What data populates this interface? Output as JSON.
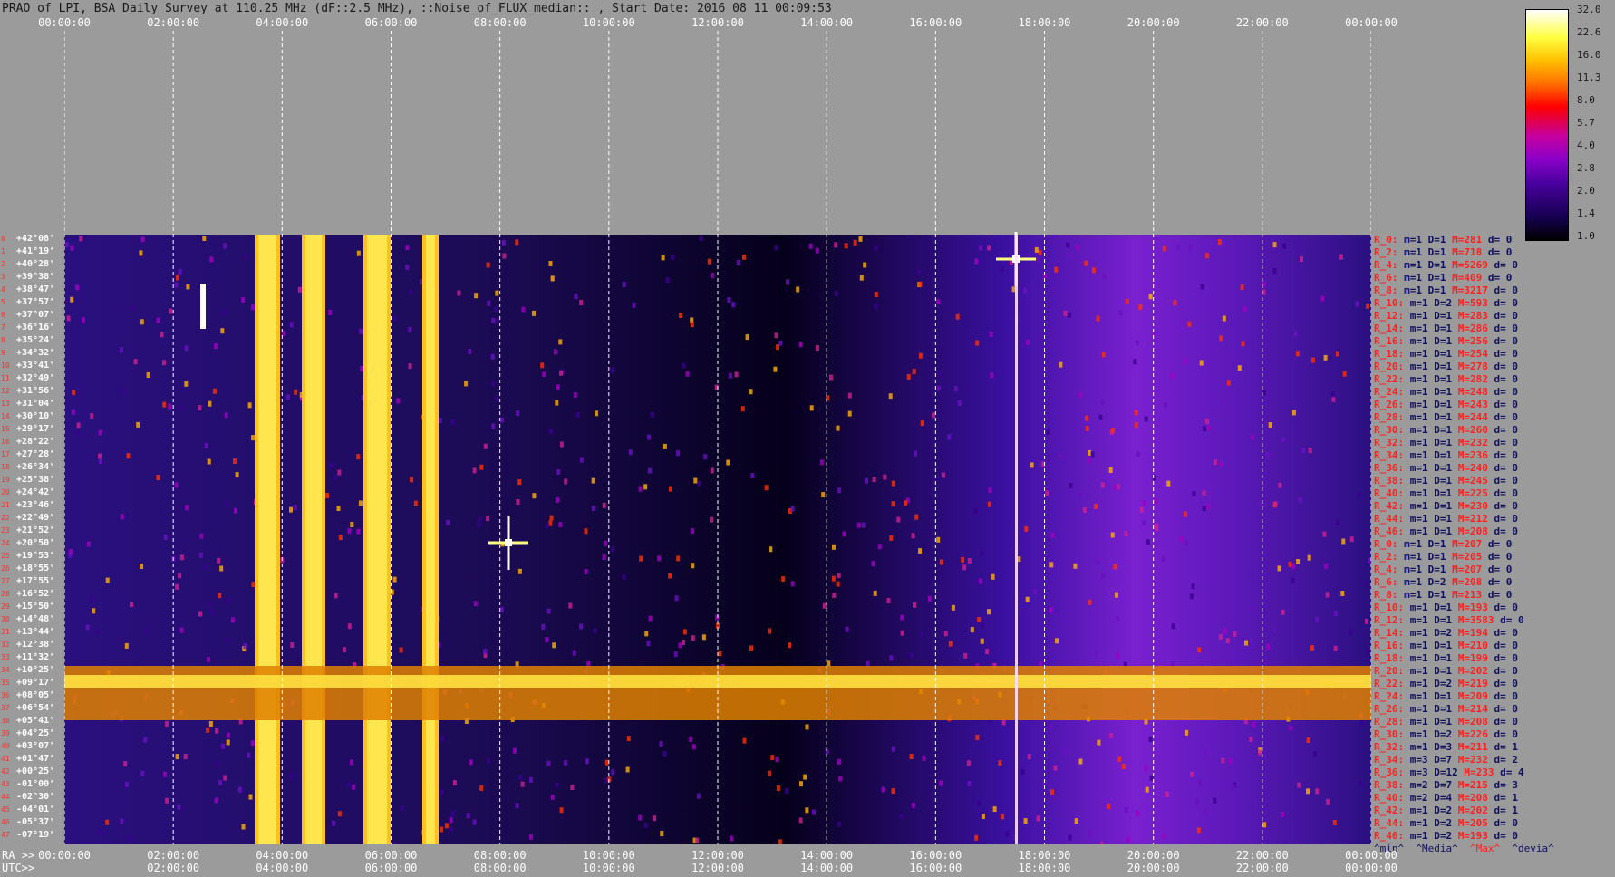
{
  "title": "PRAO of LPI, BSA Daily Survey at 110.25 MHz (dF::2.5 MHz), ::Noise_of_FLUX_median:: , Start Date: 2016 08 11 00:09:53",
  "chart_data": {
    "type": "heatmap",
    "x_ticks_top": [
      "00:00:00",
      "02:00:00",
      "04:00:00",
      "06:00:00",
      "08:00:00",
      "10:00:00",
      "12:00:00",
      "14:00:00",
      "16:00:00",
      "18:00:00",
      "20:00:00",
      "22:00:00",
      "00:00:00"
    ],
    "ra_ticks": [
      "00:00:00",
      "02:00:00",
      "04:00:00",
      "06:00:00",
      "08:00:00",
      "10:00:00",
      "12:00:00",
      "14:00:00",
      "16:00:00",
      "18:00:00",
      "20:00:00",
      "22:00:00",
      "00:00:00"
    ],
    "utc_ticks": [
      "02:00:00",
      "04:00:00",
      "06:00:00",
      "08:00:00",
      "10:00:00",
      "12:00:00",
      "14:00:00",
      "16:00:00",
      "18:00:00",
      "20:00:00",
      "22:00:00",
      "00:00:00"
    ],
    "ra_label": "RA >>",
    "utc_label": "UTC>>",
    "declinations": [
      "+42°08'",
      "+41°19'",
      "+40°28'",
      "+39°38'",
      "+38°47'",
      "+37°57'",
      "+37°07'",
      "+36°16'",
      "+35°24'",
      "+34°32'",
      "+33°41'",
      "+32°49'",
      "+31°56'",
      "+31°04'",
      "+30°10'",
      "+29°17'",
      "+28°22'",
      "+27°28'",
      "+26°34'",
      "+25°38'",
      "+24°42'",
      "+23°46'",
      "+22°49'",
      "+21°52'",
      "+20°50'",
      "+19°53'",
      "+18°55'",
      "+17°55'",
      "+16°52'",
      "+15°50'",
      "+14°48'",
      "+13°44'",
      "+12°38'",
      "+11°32'",
      "+10°25'",
      "+09°17'",
      "+08°05'",
      "+06°54'",
      "+05°41'",
      "+04°25'",
      "+03°07'",
      "+01°47'",
      "+00°25'",
      "-01°00'",
      "-02°30'",
      "-04°01'",
      "-05°37'",
      "-07°19'"
    ],
    "colorbar_ticks": [
      "32.0",
      "22.6",
      "16.0",
      "11.3",
      "8.0",
      "5.7",
      "4.0",
      "2.8",
      "2.0",
      "1.4",
      "1.0"
    ],
    "row_stats": [
      {
        "label": "R_0:",
        "m": "m=1",
        "D": "D=1",
        "M": "M=281",
        "d": "d= 0"
      },
      {
        "label": "R_2:",
        "m": "m=1",
        "D": "D=1",
        "M": "M=718",
        "d": "d= 0"
      },
      {
        "label": "R_4:",
        "m": "m=1",
        "D": "D=1",
        "M": "M=5269",
        "d": "d= 0"
      },
      {
        "label": "R_6:",
        "m": "m=1",
        "D": "D=1",
        "M": "M=409",
        "d": "d= 0"
      },
      {
        "label": "R_8:",
        "m": "m=1",
        "D": "D=1",
        "M": "M=3217",
        "d": "d= 0"
      },
      {
        "label": "R_10:",
        "m": "m=1",
        "D": "D=2",
        "M": "M=593",
        "d": "d= 0"
      },
      {
        "label": "R_12:",
        "m": "m=1",
        "D": "D=1",
        "M": "M=283",
        "d": "d= 0"
      },
      {
        "label": "R_14:",
        "m": "m=1",
        "D": "D=1",
        "M": "M=286",
        "d": "d= 0"
      },
      {
        "label": "R_16:",
        "m": "m=1",
        "D": "D=1",
        "M": "M=256",
        "d": "d= 0"
      },
      {
        "label": "R_18:",
        "m": "m=1",
        "D": "D=1",
        "M": "M=254",
        "d": "d= 0"
      },
      {
        "label": "R_20:",
        "m": "m=1",
        "D": "D=1",
        "M": "M=278",
        "d": "d= 0"
      },
      {
        "label": "R_22:",
        "m": "m=1",
        "D": "D=1",
        "M": "M=282",
        "d": "d= 0"
      },
      {
        "label": "R_24:",
        "m": "m=1",
        "D": "D=1",
        "M": "M=248",
        "d": "d= 0"
      },
      {
        "label": "R_26:",
        "m": "m=1",
        "D": "D=1",
        "M": "M=243",
        "d": "d= 0"
      },
      {
        "label": "R_28:",
        "m": "m=1",
        "D": "D=1",
        "M": "M=244",
        "d": "d= 0"
      },
      {
        "label": "R_30:",
        "m": "m=1",
        "D": "D=1",
        "M": "M=260",
        "d": "d= 0"
      },
      {
        "label": "R_32:",
        "m": "m=1",
        "D": "D=1",
        "M": "M=232",
        "d": "d= 0"
      },
      {
        "label": "R_34:",
        "m": "m=1",
        "D": "D=1",
        "M": "M=236",
        "d": "d= 0"
      },
      {
        "label": "R_36:",
        "m": "m=1",
        "D": "D=1",
        "M": "M=240",
        "d": "d= 0"
      },
      {
        "label": "R_38:",
        "m": "m=1",
        "D": "D=1",
        "M": "M=245",
        "d": "d= 0"
      },
      {
        "label": "R_40:",
        "m": "m=1",
        "D": "D=1",
        "M": "M=225",
        "d": "d= 0"
      },
      {
        "label": "R_42:",
        "m": "m=1",
        "D": "D=1",
        "M": "M=230",
        "d": "d= 0"
      },
      {
        "label": "R_44:",
        "m": "m=1",
        "D": "D=1",
        "M": "M=212",
        "d": "d= 0"
      },
      {
        "label": "R_46:",
        "m": "m=1",
        "D": "D=1",
        "M": "M=208",
        "d": "d= 0"
      },
      {
        "label": "R_0:",
        "m": "m=1",
        "D": "D=1",
        "M": "M=207",
        "d": "d= 0"
      },
      {
        "label": "R_2:",
        "m": "m=1",
        "D": "D=1",
        "M": "M=205",
        "d": "d= 0"
      },
      {
        "label": "R_4:",
        "m": "m=1",
        "D": "D=1",
        "M": "M=207",
        "d": "d= 0"
      },
      {
        "label": "R_6:",
        "m": "m=1",
        "D": "D=2",
        "M": "M=208",
        "d": "d= 0"
      },
      {
        "label": "R_8:",
        "m": "m=1",
        "D": "D=1",
        "M": "M=213",
        "d": "d= 0"
      },
      {
        "label": "R_10:",
        "m": "m=1",
        "D": "D=1",
        "M": "M=193",
        "d": "d= 0"
      },
      {
        "label": "R_12:",
        "m": "m=1",
        "D": "D=1",
        "M": "M=3583",
        "d": "d= 0"
      },
      {
        "label": "R_14:",
        "m": "m=1",
        "D": "D=2",
        "M": "M=194",
        "d": "d= 0"
      },
      {
        "label": "R_16:",
        "m": "m=1",
        "D": "D=1",
        "M": "M=210",
        "d": "d= 0"
      },
      {
        "label": "R_18:",
        "m": "m=1",
        "D": "D=1",
        "M": "M=199",
        "d": "d= 0"
      },
      {
        "label": "R_20:",
        "m": "m=1",
        "D": "D=1",
        "M": "M=202",
        "d": "d= 0"
      },
      {
        "label": "R_22:",
        "m": "m=1",
        "D": "D=2",
        "M": "M=219",
        "d": "d= 0"
      },
      {
        "label": "R_24:",
        "m": "m=1",
        "D": "D=1",
        "M": "M=209",
        "d": "d= 0"
      },
      {
        "label": "R_26:",
        "m": "m=1",
        "D": "D=1",
        "M": "M=214",
        "d": "d= 0"
      },
      {
        "label": "R_28:",
        "m": "m=1",
        "D": "D=1",
        "M": "M=208",
        "d": "d= 0"
      },
      {
        "label": "R_30:",
        "m": "m=1",
        "D": "D=2",
        "M": "M=226",
        "d": "d= 0"
      },
      {
        "label": "R_32:",
        "m": "m=1",
        "D": "D=3",
        "M": "M=211",
        "d": "d= 1"
      },
      {
        "label": "R_34:",
        "m": "m=3",
        "D": "D=7",
        "M": "M=232",
        "d": "d= 2"
      },
      {
        "label": "R_36:",
        "m": "m=3",
        "D": "D=12",
        "M": "M=233",
        "d": "d= 4"
      },
      {
        "label": "R_38:",
        "m": "m=2",
        "D": "D=7",
        "M": "M=215",
        "d": "d= 3"
      },
      {
        "label": "R_40:",
        "m": "m=2",
        "D": "D=4",
        "M": "M=208",
        "d": "d= 1"
      },
      {
        "label": "R_42:",
        "m": "m=1",
        "D": "D=2",
        "M": "M=202",
        "d": "d= 1"
      },
      {
        "label": "R_44:",
        "m": "m=1",
        "D": "D=2",
        "M": "M=205",
        "d": "d= 0"
      },
      {
        "label": "R_46:",
        "m": "m=1",
        "D": "D=2",
        "M": "M=193",
        "d": "d= 0"
      }
    ],
    "legend": [
      {
        "text": "^min^",
        "color": "#101060"
      },
      {
        "text": "^Media^",
        "color": "#101060"
      },
      {
        "text": "^Max^",
        "color": "#ff2020"
      },
      {
        "text": "^devia^",
        "color": "#101060"
      }
    ]
  }
}
